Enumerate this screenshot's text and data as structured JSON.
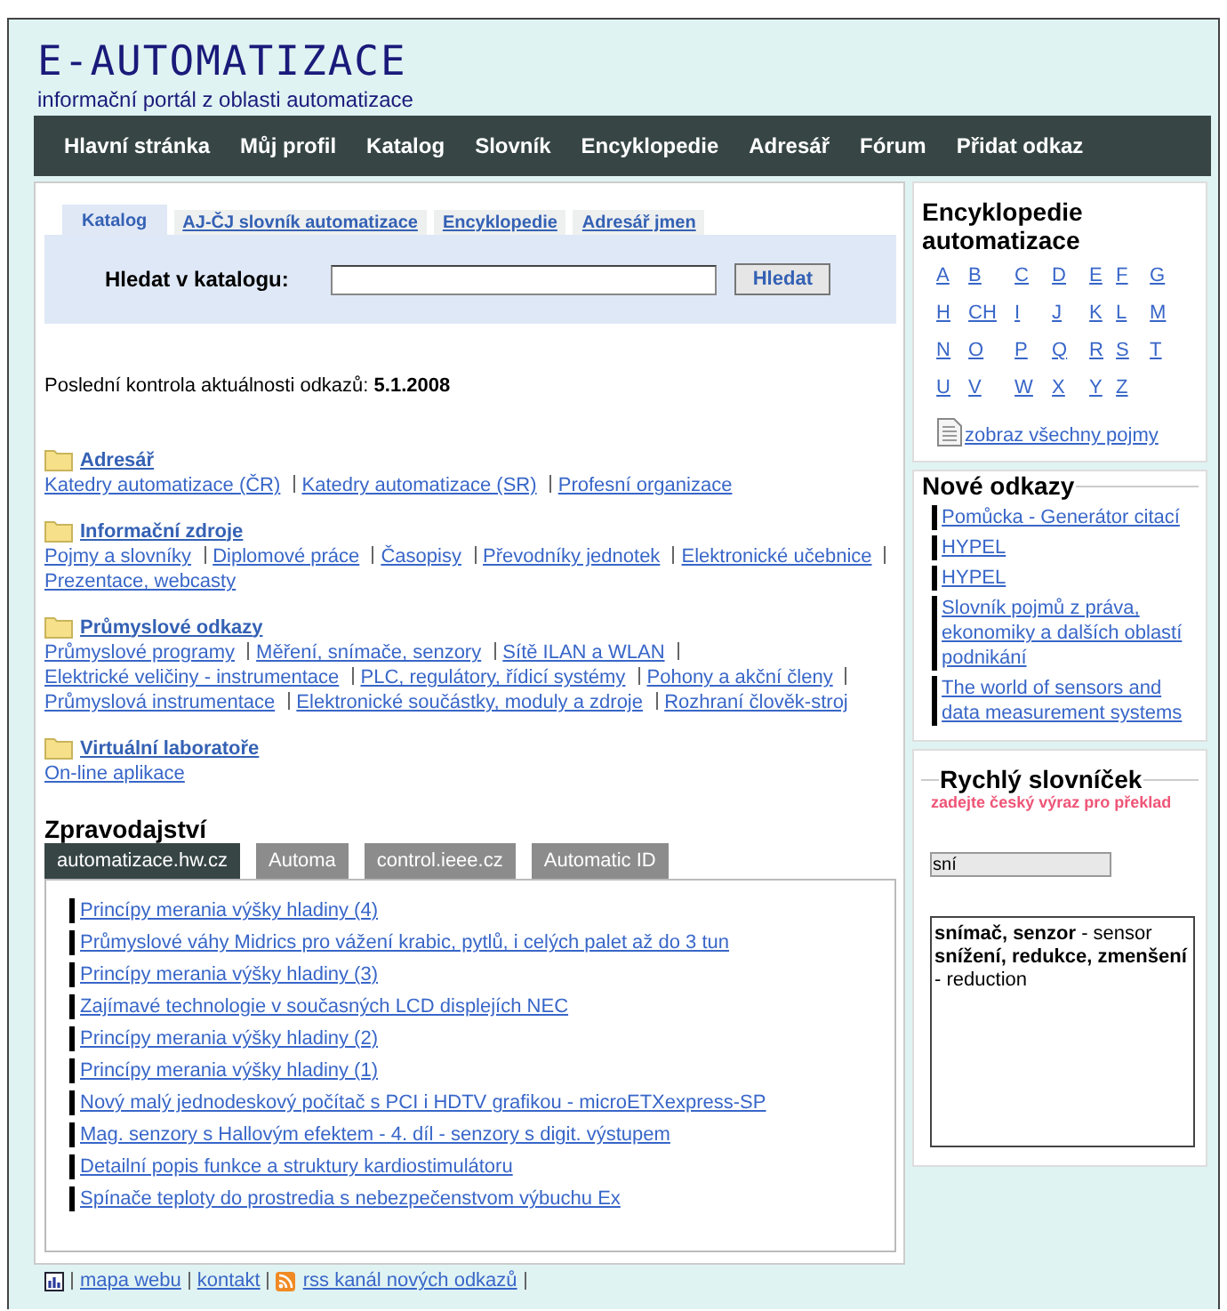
{
  "header": {
    "logo": "E-AUTOMATIZACE",
    "tagline": "informační portál z oblasti automatizace"
  },
  "nav": [
    "Hlavní stránka",
    "Můj profil",
    "Katalog",
    "Slovník",
    "Encyklopedie",
    "Adresář",
    "Fórum",
    "Přidat odkaz"
  ],
  "search_tabs": [
    {
      "label": "Katalog",
      "selected": true
    },
    {
      "label": "AJ-ČJ slovník automatizace",
      "selected": false
    },
    {
      "label": "Encyklopedie",
      "selected": false
    },
    {
      "label": "Adresář jmen",
      "selected": false
    }
  ],
  "search": {
    "label": "Hledat v katalogu:",
    "button": "Hledat"
  },
  "last_check": "Poslední kontrola aktuálnosti odkazů: **5.1.2008**",
  "categories": [
    {
      "title": "Adresář",
      "links": [
        "Katedry automatizace (ČR)",
        "Katedry automatizace (SR)",
        "Profesní organizace"
      ]
    },
    {
      "title": "Informační zdroje",
      "links": [
        "Pojmy a slovníky",
        "Diplomové práce",
        "Časopisy",
        "Převodníky jednotek",
        "Elektronické učebnice",
        "Prezentace, webcasty"
      ]
    },
    {
      "title": "Průmyslové odkazy",
      "links": [
        "Průmyslové programy",
        "Měření, snímače, senzory",
        "Sítě ILAN a WLAN",
        "Elektrické veličiny - instrumentace",
        "PLC, regulátory, řídicí systémy",
        "Pohony a akční členy",
        "Průmyslová instrumentace",
        "Elektronické součástky, moduly a zdroje",
        "Rozhraní člověk-stroj"
      ]
    },
    {
      "title": "Virtuální laboratoře",
      "links": [
        "On-line aplikace"
      ]
    }
  ],
  "news": {
    "title": "Zpravodajství",
    "tabs": [
      {
        "label": "automatizace.hw.cz",
        "selected": true
      },
      {
        "label": "Automa",
        "selected": false
      },
      {
        "label": "control.ieee.cz",
        "selected": false
      },
      {
        "label": "Automatic ID",
        "selected": false
      }
    ],
    "items": [
      "Princípy merania výšky hladiny (4)",
      "Průmyslové váhy Midrics pro vážení krabic, pytlů, i celých palet až do 3 tun",
      "Princípy merania výšky hladiny (3)",
      "Zajímavé technologie v současných LCD displejích NEC",
      "Princípy merania výšky hladiny (2)",
      "Princípy merania výšky hladiny (1)",
      "Nový malý jednodeskový počítač s PCI i HDTV grafikou - microETXexpress-SP",
      "Mag. senzory s Hallovým efektem - 4. díl - senzory s digit. výstupem",
      "Detailní popis funkce a struktury kardiostimulátoru",
      "Spínače teploty do prostredia s nebezpečenstvom výbuchu Ex"
    ]
  },
  "footer": [
    "mapa webu",
    "kontakt",
    "rss kanál nových odkazů"
  ],
  "encyclopedia": {
    "title": "Encyklopedie automatizace",
    "letters": [
      "A",
      "B",
      "C",
      "D",
      "E",
      "F",
      "G",
      "H",
      "CH",
      "I",
      "J",
      "K",
      "L",
      "M",
      "N",
      "O",
      "P",
      "Q",
      "R",
      "S",
      "T",
      "U",
      "V",
      "W",
      "X",
      "Y",
      "Z"
    ],
    "all_link": "zobraz všechny pojmy"
  },
  "new_links": {
    "title": "Nové odkazy",
    "items": [
      "Pomůcka - Generátor citací",
      "HYPEL",
      "HYPEL",
      "Slovník pojmů z práva, ekonomiky a dalších oblastí podnikání",
      "The world of sensors and data measurement systems"
    ]
  },
  "quick_dictionary": {
    "title": "Rychlý slovníček",
    "hint": "zadejte český výraz pro překlad",
    "value": "sní",
    "results": [
      "**snímač, senzor** - sensor",
      "**snížení, redukce, zmenšení** - reduction"
    ]
  }
}
